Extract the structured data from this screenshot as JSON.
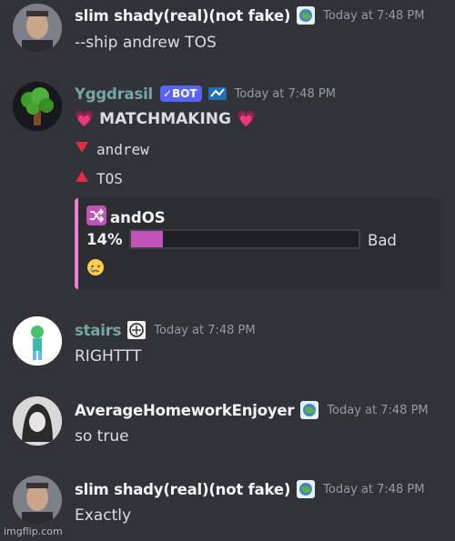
{
  "messages": [
    {
      "author": "slim shady(real)(not fake)",
      "timestamp": "Today at 7:48 PM",
      "text": "--ship andrew TOS"
    },
    {
      "author": "Yggdrasil",
      "bot_tag": "BOT",
      "timestamp": "Today at 7:48 PM",
      "title": "MATCHMAKING",
      "down_user": "andrew",
      "up_user": "TOS",
      "embed": {
        "name": "andOS",
        "percent_label": "14%",
        "percent": 0.14,
        "rating": "Bad",
        "emoji": "crying-face"
      }
    },
    {
      "author": "stairs",
      "timestamp": "Today at 7:48 PM",
      "text": "RIGHTTT"
    },
    {
      "author": "AverageHomeworkEnjoyer",
      "timestamp": "Today at 7:48 PM",
      "text": "so true"
    },
    {
      "author": "slim shady(real)(not fake)",
      "timestamp": "Today at 7:48 PM",
      "text": "Exactly"
    }
  ],
  "watermark": "imgflip.com",
  "colors": {
    "background": "#323339",
    "embed_border": "#eb7fd6",
    "bar_fill": "#c154b9",
    "bot_tag": "#5865f2"
  }
}
